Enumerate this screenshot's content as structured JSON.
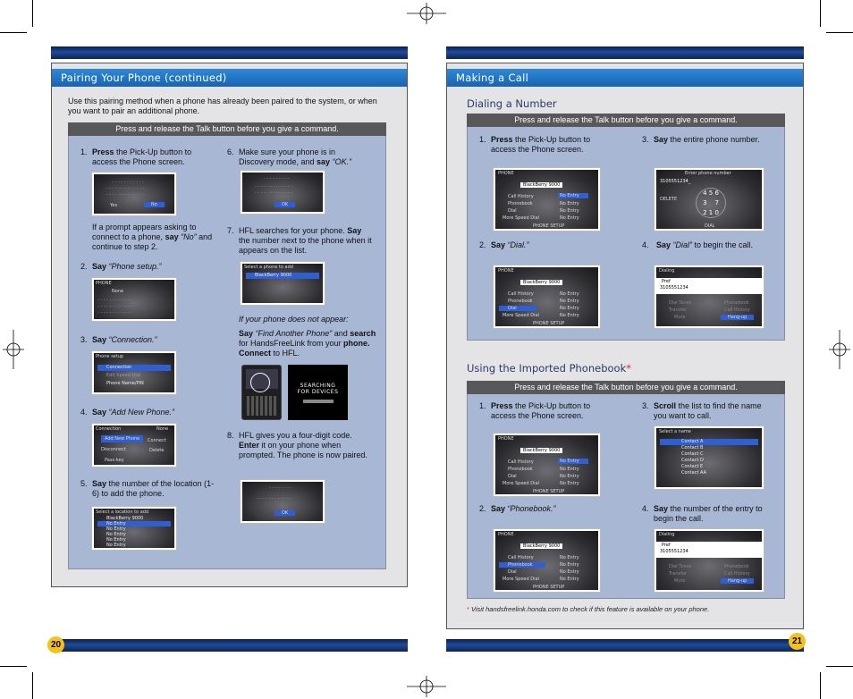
{
  "left_page": {
    "section_title": "Pairing Your Phone (continued)",
    "intro": "Use this pairing method when a phone has already been paired to the system, or when you want to pair an additional phone.",
    "talk_bar": "Press and release the Talk button before you give a command.",
    "page_number": "20",
    "steps": {
      "s1": {
        "num": "1.",
        "verb": "Press",
        "rest": " the Pick-Up button to access the Phone screen."
      },
      "s1_note": {
        "pre": "If a prompt appears asking to connect to a phone, ",
        "verb": "say",
        "quote": " “No”",
        "rest": " and continue to step 2."
      },
      "s2": {
        "num": "2.",
        "verb": "Say",
        "quote": " “Phone setup.”"
      },
      "s3": {
        "num": "3.",
        "verb": "Say",
        "quote": " “Connection.”"
      },
      "s4": {
        "num": "4.",
        "verb": "Say",
        "quote": " “Add New Phone.”"
      },
      "s5": {
        "num": "5.",
        "verb": "Say",
        "rest": " the number of the location (1-6) to add the phone."
      },
      "s6": {
        "num": "6.",
        "pre": "Make sure your phone is in Discovery mode, and ",
        "verb": "say",
        "quote": " “OK.”"
      },
      "s7": {
        "num": "7.",
        "pre": "HFL searches for your phone. ",
        "verb": "Say",
        "rest": " the number next to the phone when it appears on the list."
      },
      "s7_note": "If your phone does not appear:",
      "s7_say": {
        "verb": "Say",
        "quote": " “Find Another Phone”",
        "and": " and ",
        "search": "search",
        "rest1": " for HandsFreeLink from your ",
        "phone_connect": "phone. Connect",
        "rest2": " to HFL."
      },
      "s8": {
        "num": "8.",
        "pre": "HFL gives you a four-digit code. ",
        "verb": "Enter",
        "rest": " it on your phone when prompted.  The phone is now paired."
      }
    },
    "screens": {
      "prompt": {
        "yes": "Yes",
        "no": "No"
      },
      "phone": {
        "title": "PHONE",
        "item": "None"
      },
      "setup": {
        "title": "Phone setup",
        "items": [
          "Connection",
          "Edit Speed Dial",
          "Phone Name/PIN"
        ]
      },
      "connection": {
        "title": "Connection",
        "none": "None",
        "items": [
          "Add New Phone",
          "Connect",
          "Disconnect",
          "Delete",
          "Pass-key"
        ]
      },
      "location": {
        "title": "Select a location to add",
        "items": [
          "BlackBerry 9000",
          "No Entry",
          "No Entry",
          "No Entry",
          "No Entry",
          "No Entry"
        ]
      },
      "ok_prompt": {
        "ok": "OK"
      },
      "phone_add": {
        "title": "Select a phone to add",
        "item": "BlackBerry 9000"
      },
      "searching": {
        "line1": "SEARCHING",
        "line2": "FOR DEVICES"
      },
      "code": {
        "ok": "OK"
      }
    }
  },
  "right_page": {
    "section_title": "Making a Call",
    "page_number": "21",
    "dialing": {
      "subtitle": "Dialing a Number",
      "talk_bar": "Press and release the Talk button before you give a command.",
      "s1": {
        "num": "1.",
        "verb": "Press",
        "rest": " the Pick-Up button to access the Phone screen."
      },
      "s2": {
        "num": "2.",
        "verb": "Say",
        "quote": " “Dial.”"
      },
      "s3": {
        "num": "3.",
        "verb": "Say",
        "rest": " the entire phone number."
      },
      "s4": {
        "num": "4.",
        "verb": "Say",
        "quote": " “Dial”",
        "rest": " to begin the call."
      }
    },
    "phonebook": {
      "subtitle": "Using the Imported Phonebook",
      "star": "*",
      "talk_bar": "Press and release the Talk button before you give a command.",
      "s1": {
        "num": "1.",
        "verb": "Press",
        "rest": " the Pick-Up button to access the Phone screen."
      },
      "s2": {
        "num": "2.",
        "verb": "Say",
        "quote": " “Phonebook.”"
      },
      "s3": {
        "num": "3.",
        "verb": "Scroll",
        "rest": " the list to find the name you want to call."
      },
      "s4": {
        "num": "4.",
        "verb": "Say",
        "rest": " the number of the entry to begin the call."
      }
    },
    "footnote": {
      "star": "*",
      "text": "Visit handsfreelink.honda.com to check if this feature is available on your phone."
    },
    "screens": {
      "phone": {
        "title": "PHONE",
        "device": "BlackBerry 9000",
        "menu": [
          "Call History",
          "Phonebook",
          "Dial",
          "More Speed Dial"
        ],
        "entries": [
          "No Entry",
          "No Entry",
          "No Entry",
          "No Entry"
        ],
        "setup": "PHONE SETUP"
      },
      "enter": {
        "title": "Enter phone number",
        "number": "3105551234_",
        "delete": "DELETE",
        "dial": "DIAL"
      },
      "dialing": {
        "title": "Dialing",
        "pref": "Pref",
        "number": "3105551234",
        "left": [
          "Dial Tones",
          "Transfer",
          "Mute"
        ],
        "right": [
          "Phonebook",
          "Call History",
          "Hang-up"
        ]
      },
      "select_name": {
        "title": "Select a name",
        "contacts": [
          "Contact A",
          "Contact B",
          "Contact C",
          "Contact D",
          "Contact E",
          "Contact AA"
        ]
      }
    }
  }
}
